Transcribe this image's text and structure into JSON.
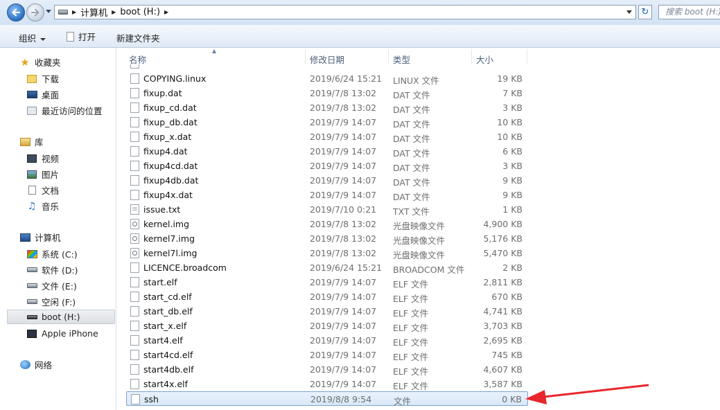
{
  "address": {
    "crumbs": [
      "计算机",
      "boot (H:)"
    ],
    "search_placeholder": "搜索 boot (H:)"
  },
  "toolbar": {
    "organize": "组织",
    "open": "打开",
    "new_folder": "新建文件夹"
  },
  "nav": {
    "favorites": {
      "label": "收藏夹",
      "items": [
        "下载",
        "桌面",
        "最近访问的位置"
      ]
    },
    "libraries": {
      "label": "库",
      "items": [
        "视频",
        "图片",
        "文档",
        "音乐"
      ]
    },
    "computer": {
      "label": "计算机",
      "items": [
        "系统 (C:)",
        "软件 (D:)",
        "文件 (E:)",
        "空闲 (F:)",
        "boot (H:)",
        "Apple iPhone"
      ]
    },
    "network": {
      "label": "网络"
    },
    "selected": "boot (H:)"
  },
  "columns": {
    "name": "名称",
    "date": "修改日期",
    "type": "类型",
    "size": "大小"
  },
  "files": [
    {
      "name": "COPYING.linux",
      "date": "2019/6/24 15:21",
      "type": "LINUX 文件",
      "size": "19 KB",
      "icon": "file-icon"
    },
    {
      "name": "fixup.dat",
      "date": "2019/7/8 13:02",
      "type": "DAT 文件",
      "size": "7 KB",
      "icon": "file-icon"
    },
    {
      "name": "fixup_cd.dat",
      "date": "2019/7/8 13:02",
      "type": "DAT 文件",
      "size": "3 KB",
      "icon": "file-icon"
    },
    {
      "name": "fixup_db.dat",
      "date": "2019/7/9 14:07",
      "type": "DAT 文件",
      "size": "10 KB",
      "icon": "file-icon"
    },
    {
      "name": "fixup_x.dat",
      "date": "2019/7/9 14:07",
      "type": "DAT 文件",
      "size": "10 KB",
      "icon": "file-icon"
    },
    {
      "name": "fixup4.dat",
      "date": "2019/7/9 14:07",
      "type": "DAT 文件",
      "size": "6 KB",
      "icon": "file-icon"
    },
    {
      "name": "fixup4cd.dat",
      "date": "2019/7/9 14:07",
      "type": "DAT 文件",
      "size": "3 KB",
      "icon": "file-icon"
    },
    {
      "name": "fixup4db.dat",
      "date": "2019/7/9 14:07",
      "type": "DAT 文件",
      "size": "9 KB",
      "icon": "file-icon"
    },
    {
      "name": "fixup4x.dat",
      "date": "2019/7/9 14:07",
      "type": "DAT 文件",
      "size": "9 KB",
      "icon": "file-icon"
    },
    {
      "name": "issue.txt",
      "date": "2019/7/10 0:21",
      "type": "TXT 文件",
      "size": "1 KB",
      "icon": "text-file-icon"
    },
    {
      "name": "kernel.img",
      "date": "2019/7/8 13:02",
      "type": "光盘映像文件",
      "size": "4,900 KB",
      "icon": "disc-image-icon"
    },
    {
      "name": "kernel7.img",
      "date": "2019/7/8 13:02",
      "type": "光盘映像文件",
      "size": "5,176 KB",
      "icon": "disc-image-icon"
    },
    {
      "name": "kernel7l.img",
      "date": "2019/7/8 13:02",
      "type": "光盘映像文件",
      "size": "5,470 KB",
      "icon": "disc-image-icon"
    },
    {
      "name": "LICENCE.broadcom",
      "date": "2019/6/24 15:21",
      "type": "BROADCOM 文件",
      "size": "2 KB",
      "icon": "file-icon"
    },
    {
      "name": "start.elf",
      "date": "2019/7/9 14:07",
      "type": "ELF 文件",
      "size": "2,811 KB",
      "icon": "file-icon"
    },
    {
      "name": "start_cd.elf",
      "date": "2019/7/9 14:07",
      "type": "ELF 文件",
      "size": "670 KB",
      "icon": "file-icon"
    },
    {
      "name": "start_db.elf",
      "date": "2019/7/9 14:07",
      "type": "ELF 文件",
      "size": "4,741 KB",
      "icon": "file-icon"
    },
    {
      "name": "start_x.elf",
      "date": "2019/7/9 14:07",
      "type": "ELF 文件",
      "size": "3,703 KB",
      "icon": "file-icon"
    },
    {
      "name": "start4.elf",
      "date": "2019/7/9 14:07",
      "type": "ELF 文件",
      "size": "2,695 KB",
      "icon": "file-icon"
    },
    {
      "name": "start4cd.elf",
      "date": "2019/7/9 14:07",
      "type": "ELF 文件",
      "size": "745 KB",
      "icon": "file-icon"
    },
    {
      "name": "start4db.elf",
      "date": "2019/7/9 14:07",
      "type": "ELF 文件",
      "size": "4,607 KB",
      "icon": "file-icon"
    },
    {
      "name": "start4x.elf",
      "date": "2019/7/9 14:07",
      "type": "ELF 文件",
      "size": "3,587 KB",
      "icon": "file-icon"
    },
    {
      "name": "ssh",
      "date": "2019/8/8 9:54",
      "type": "文件",
      "size": "0 KB",
      "icon": "file-icon",
      "selected": true
    }
  ],
  "colors": {
    "annotation_arrow": "#e8262c",
    "selection_border": "#7da2ce"
  }
}
